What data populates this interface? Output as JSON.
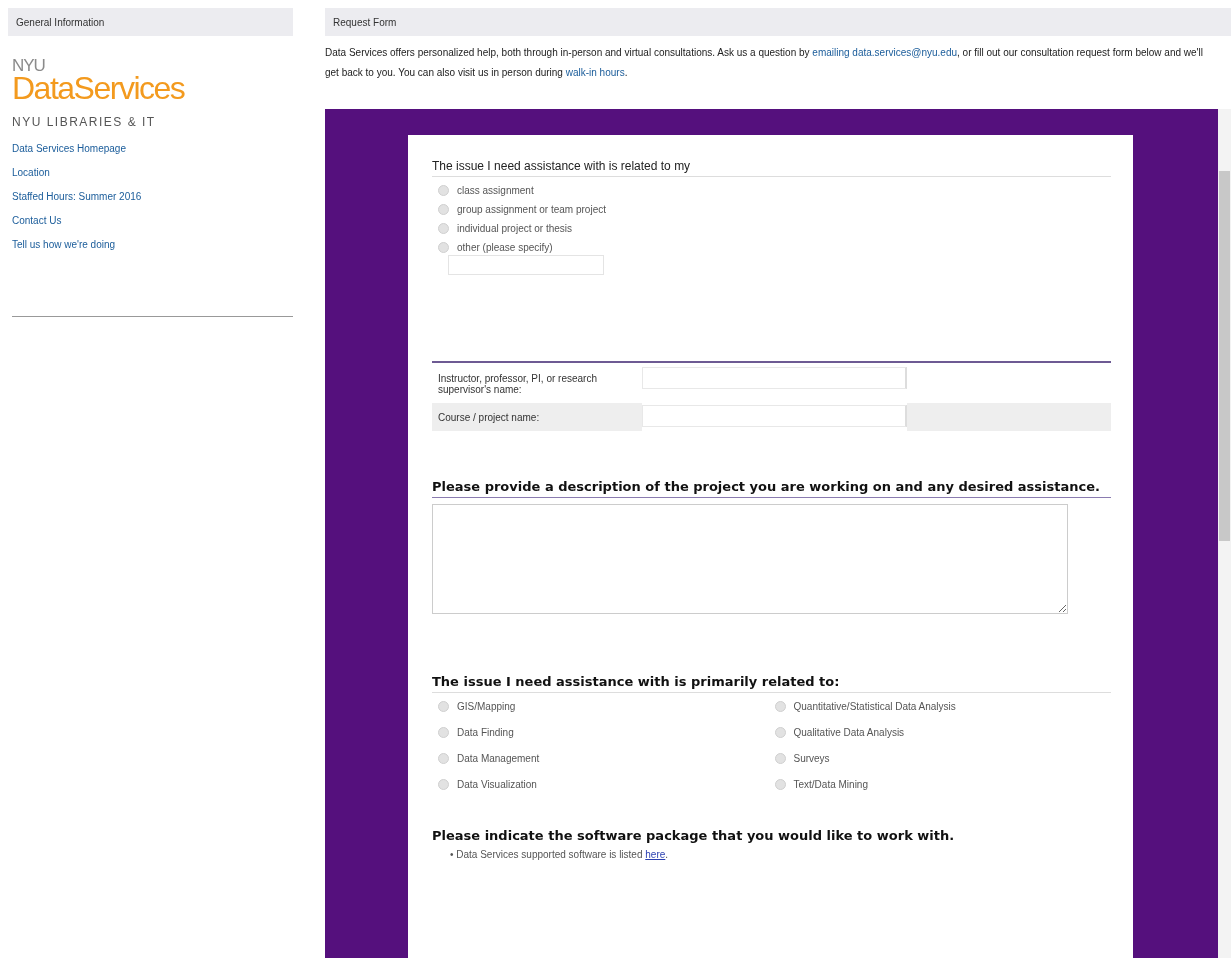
{
  "sidebar": {
    "header": "General Information",
    "logo": {
      "small": "NYU",
      "large": "DataServices"
    },
    "subtitle": "NYU LIBRARIES & IT",
    "links": [
      "Data Services Homepage",
      "Location",
      "Staffed Hours: Summer 2016",
      "Contact Us",
      "Tell us how we're doing"
    ]
  },
  "main": {
    "header": "Request Form",
    "intro": [
      {
        "kind": "text",
        "text": "Data Services offers personalized help, both through in-person and virtual consultations. Ask us a question by "
      },
      {
        "kind": "link",
        "text": "emailing data.services@nyu.edu"
      },
      {
        "kind": "text",
        "text": ", or fill out our consultation request form below and we'll get back to you. You can also visit us in person during "
      },
      {
        "kind": "link",
        "text": "walk-in hours"
      },
      {
        "kind": "text",
        "text": "."
      }
    ]
  },
  "form": {
    "q1": {
      "title": "The issue I need assistance with is related to my",
      "options": [
        {
          "label": "class assignment",
          "selected": false
        },
        {
          "label": "group assignment or team project",
          "selected": false
        },
        {
          "label": "individual project or thesis",
          "selected": false
        },
        {
          "label": "other (please specify)",
          "selected": false
        }
      ]
    },
    "fields": [
      {
        "label": "Instructor, professor, PI, or research supervisor's name:"
      },
      {
        "label": "Course / project name:"
      }
    ],
    "q2": {
      "title": "Please provide a description of the project you are working on and any desired assistance."
    },
    "q3": {
      "title": "The issue I need assistance with is primarily related to:",
      "options": [
        {
          "label": "GIS/Mapping",
          "selected": false
        },
        {
          "label": "Quantitative/Statistical Data Analysis",
          "selected": false
        },
        {
          "label": "Data Finding",
          "selected": false
        },
        {
          "label": "Qualitative Data Analysis",
          "selected": false
        },
        {
          "label": "Data Management",
          "selected": false
        },
        {
          "label": "Surveys",
          "selected": false
        },
        {
          "label": "Data Visualization",
          "selected": false
        },
        {
          "label": "Text/Data Mining",
          "selected": false
        }
      ]
    },
    "q4": {
      "title": "Please indicate the software package that you would like to work with.",
      "bullet": "•",
      "note": "Data Services supported software is listed ",
      "link": "here",
      "after": "."
    }
  }
}
